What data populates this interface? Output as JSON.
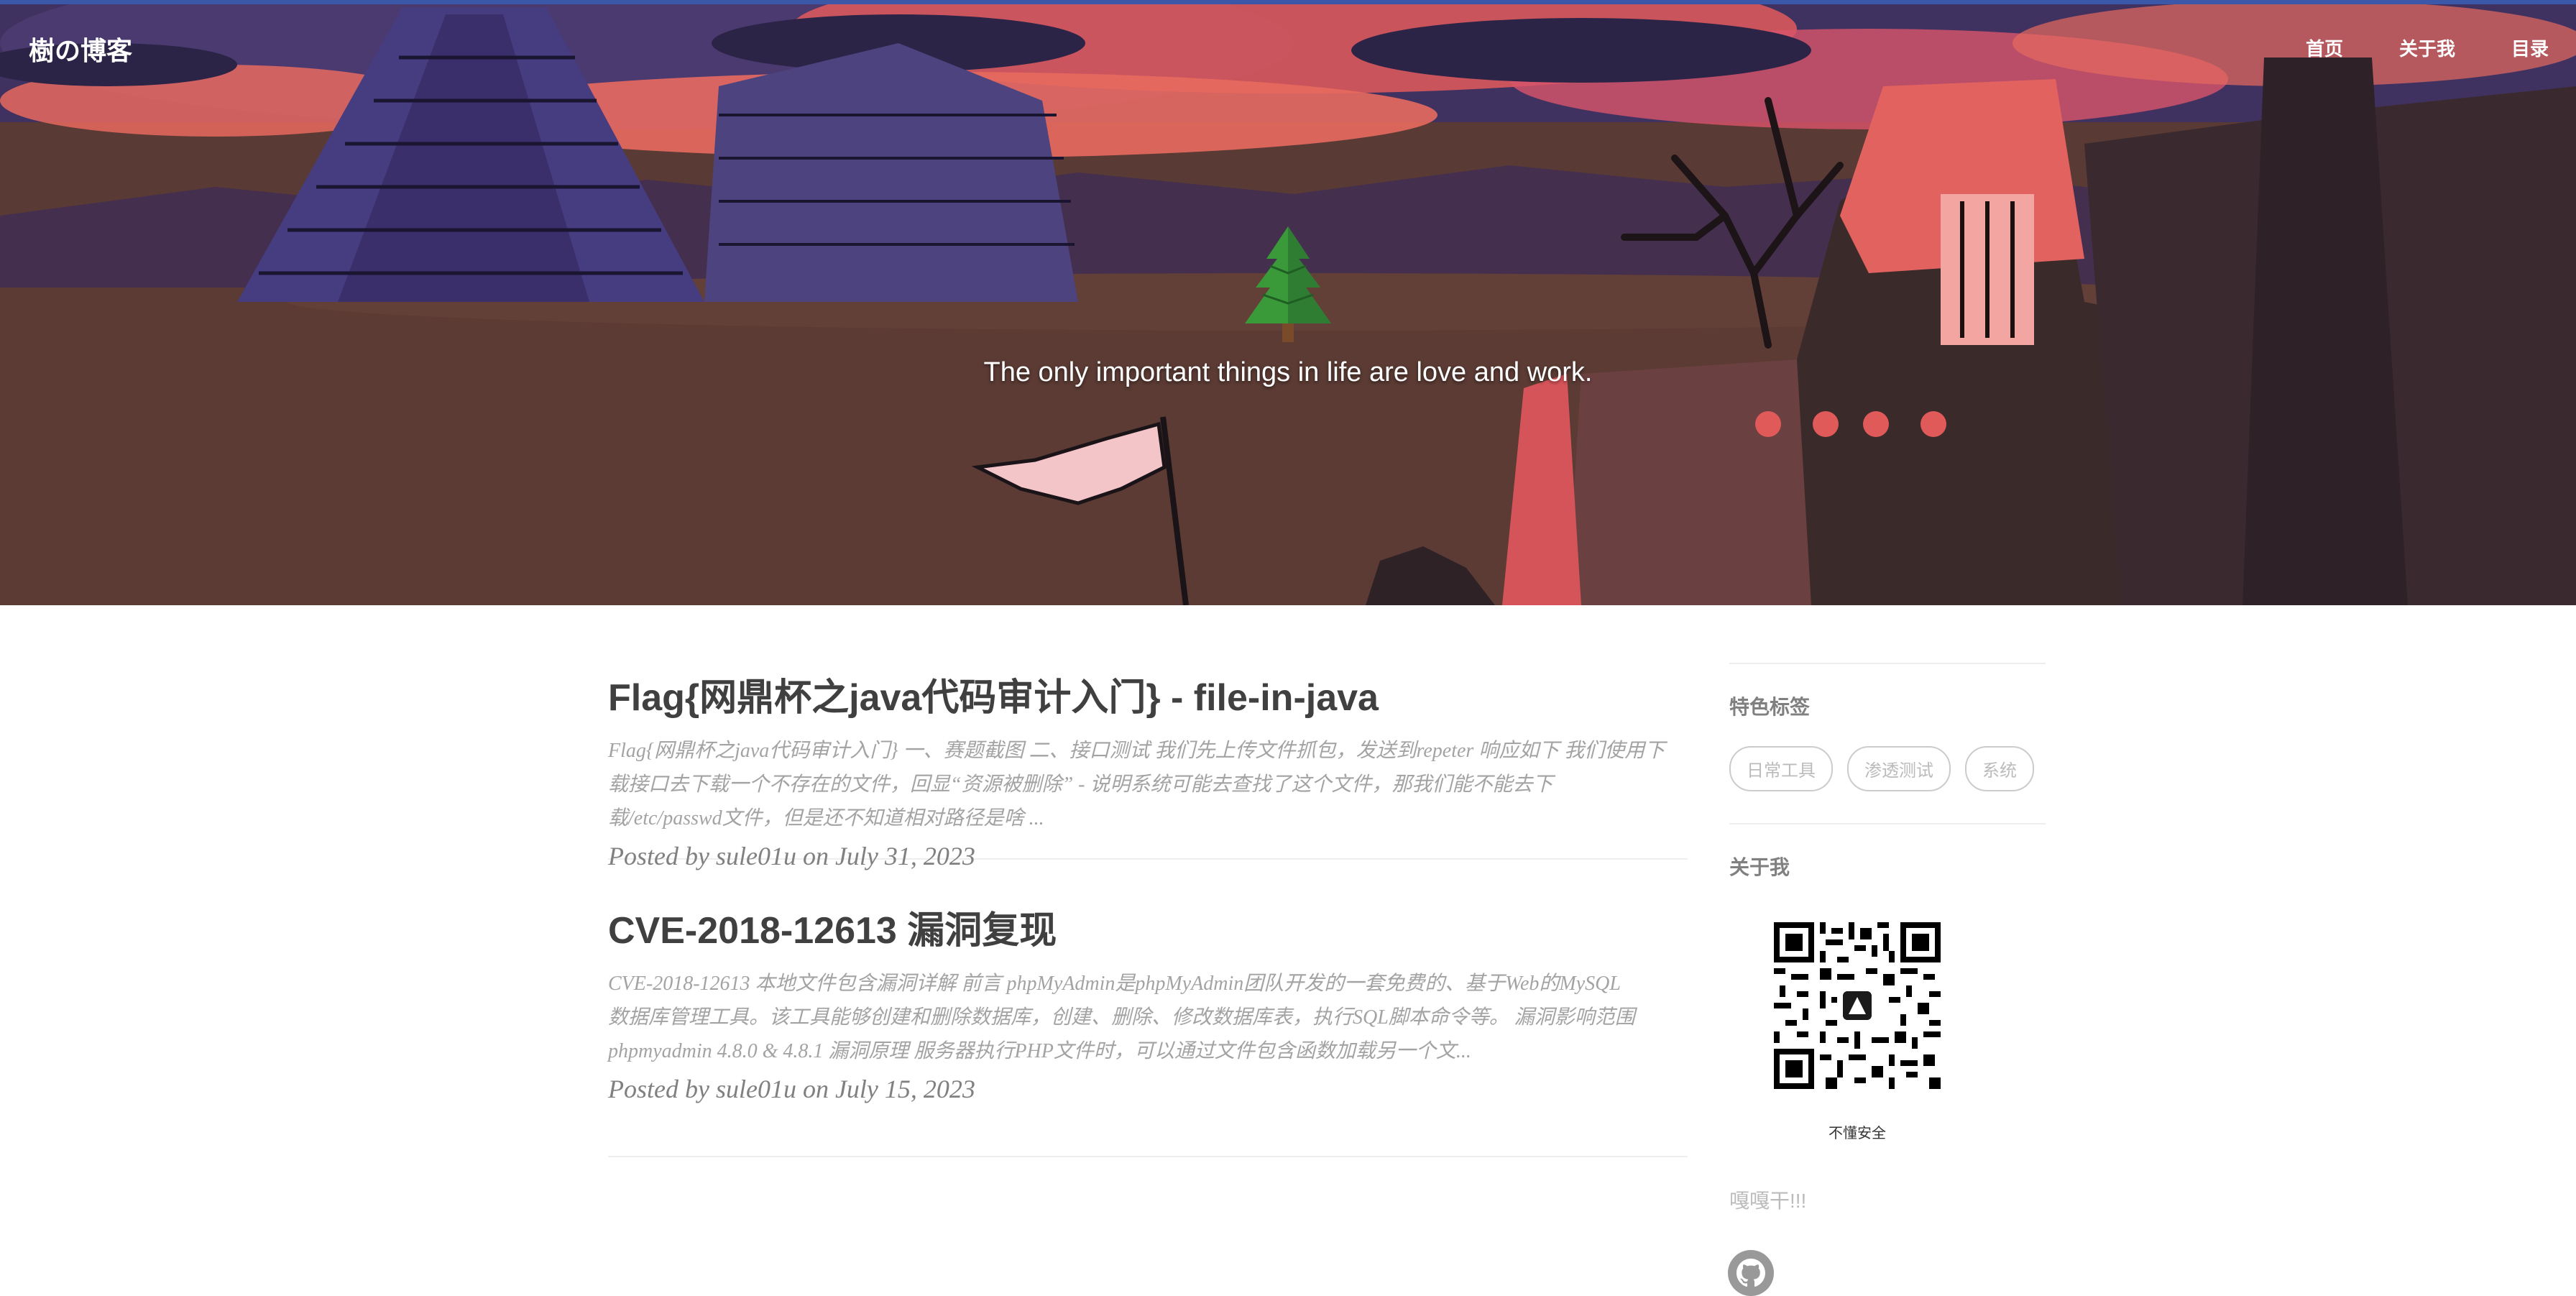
{
  "header": {
    "brand": "樹の博客",
    "nav": [
      {
        "label": "首页"
      },
      {
        "label": "关于我"
      },
      {
        "label": "目录"
      }
    ],
    "motto": "The only important things in life are love and work."
  },
  "posts": [
    {
      "title": "Flag{网鼎杯之java代码审计入门} - file-in-java",
      "excerpt_lines": [
        "Flag{网鼎杯之java代码审计入门} 一、赛题截图 二、接口测试 我们先上传文件抓包，发送到repeter 响应如下 我们使用下",
        "载接口去下载一个不存在的文件，回显“资源被删除” - 说明系统可能去查找了这个文件，那我们能不能去下",
        "载/etc/passwd文件，但是还不知道相对路径是啥 ..."
      ],
      "meta": "Posted by sule01u on July 31, 2023"
    },
    {
      "title": "CVE-2018-12613 漏洞复现",
      "excerpt_lines": [
        "CVE-2018-12613 本地文件包含漏洞详解 前言 phpMyAdmin是phpMyAdmin团队开发的一套免费的、基于Web的MySQL",
        "数据库管理工具。该工具能够创建和删除数据库，创建、删除、修改数据库表，执行SQL脚本命令等。 漏洞影响范围",
        "phpmyadmin 4.8.0 & 4.8.1 漏洞原理 服务器执行PHP文件时，可以通过文件包含函数加载另一个文..."
      ],
      "meta": "Posted by sule01u on July 15, 2023"
    }
  ],
  "sidebar": {
    "featured_tags_title": "特色标签",
    "tags": [
      "日常工具",
      "渗透测试",
      "系统"
    ],
    "about_title": "关于我",
    "qr_caption": "不懂安全",
    "friends_title": "嘎嘎干!!!",
    "github_icon": "github-icon"
  },
  "colors": {
    "accent_topline": "#3b57a8",
    "title": "#404040",
    "excerpt": "#a3a3a3",
    "meta": "#808080"
  }
}
